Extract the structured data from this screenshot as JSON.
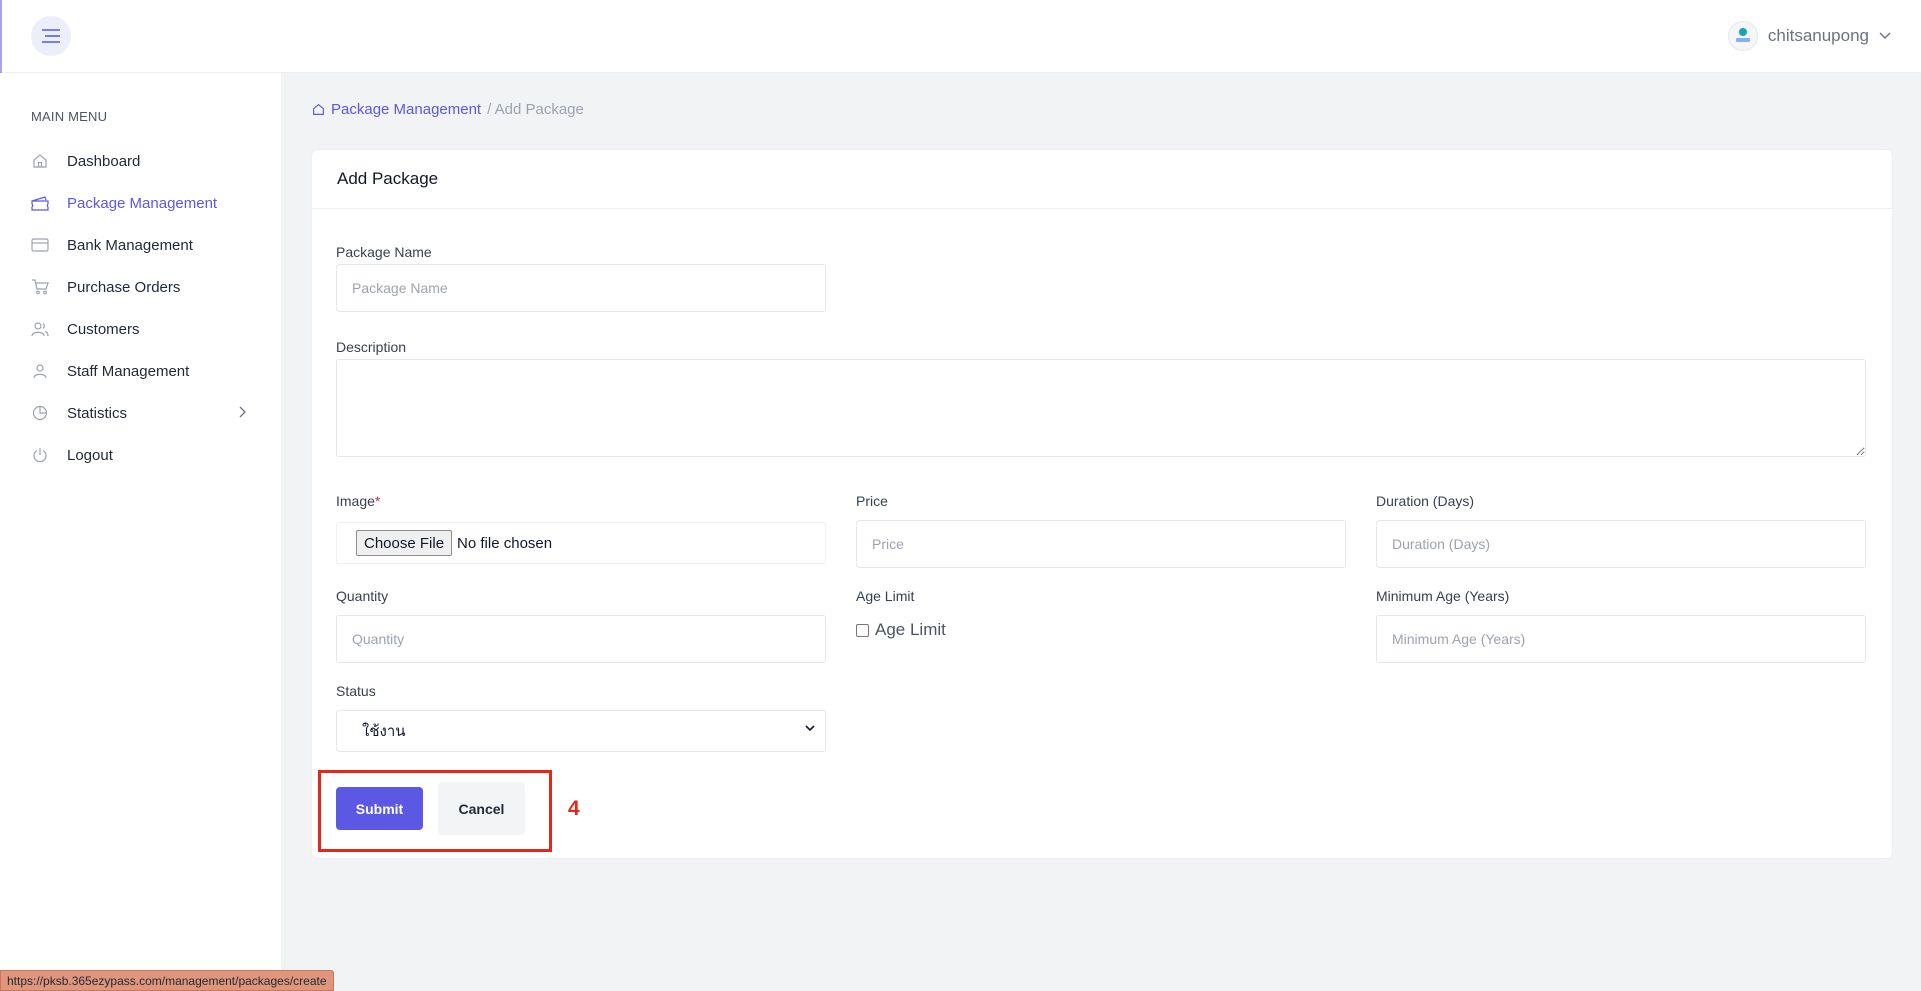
{
  "topbar": {
    "username": "chitsanupong"
  },
  "sidebar": {
    "menu_title": "MAIN MENU",
    "items": [
      {
        "label": "Dashboard",
        "icon": "home-icon"
      },
      {
        "label": "Package Management",
        "icon": "ticket-icon",
        "active": true
      },
      {
        "label": "Bank Management",
        "icon": "credit-card-icon"
      },
      {
        "label": "Purchase Orders",
        "icon": "cart-icon"
      },
      {
        "label": "Customers",
        "icon": "users-icon"
      },
      {
        "label": "Staff Management",
        "icon": "user-icon"
      },
      {
        "label": "Statistics",
        "icon": "pie-chart-icon",
        "has_submenu": true
      },
      {
        "label": "Logout",
        "icon": "power-icon"
      }
    ]
  },
  "breadcrumb": {
    "parent": "Package Management",
    "current": "/ Add Package"
  },
  "form": {
    "title": "Add Package",
    "package_name": {
      "label": "Package Name",
      "placeholder": "Package Name",
      "value": ""
    },
    "description": {
      "label": "Description",
      "value": ""
    },
    "image": {
      "label": "Image",
      "required_mark": "*",
      "button_label": "Choose File",
      "status": "No file chosen"
    },
    "price": {
      "label": "Price",
      "placeholder": "Price",
      "value": ""
    },
    "duration": {
      "label": "Duration (Days)",
      "placeholder": "Duration (Days)",
      "value": ""
    },
    "quantity": {
      "label": "Quantity",
      "placeholder": "Quantity",
      "value": ""
    },
    "age_limit": {
      "label": "Age Limit",
      "checkbox_label": "Age Limit",
      "checked": false
    },
    "minimum_age": {
      "label": "Minimum Age (Years)",
      "placeholder": "Minimum Age (Years)",
      "value": ""
    },
    "status": {
      "label": "Status",
      "selected": "ใช้งาน"
    },
    "submit_label": "Submit",
    "cancel_label": "Cancel"
  },
  "annotation": {
    "step_number": "4",
    "color": "#e3271b"
  },
  "status_bar": {
    "url": "https://pksb.365ezypass.com/management/packages/create"
  },
  "colors": {
    "accent": "#5b58e3",
    "background": "#f2f3f5"
  }
}
